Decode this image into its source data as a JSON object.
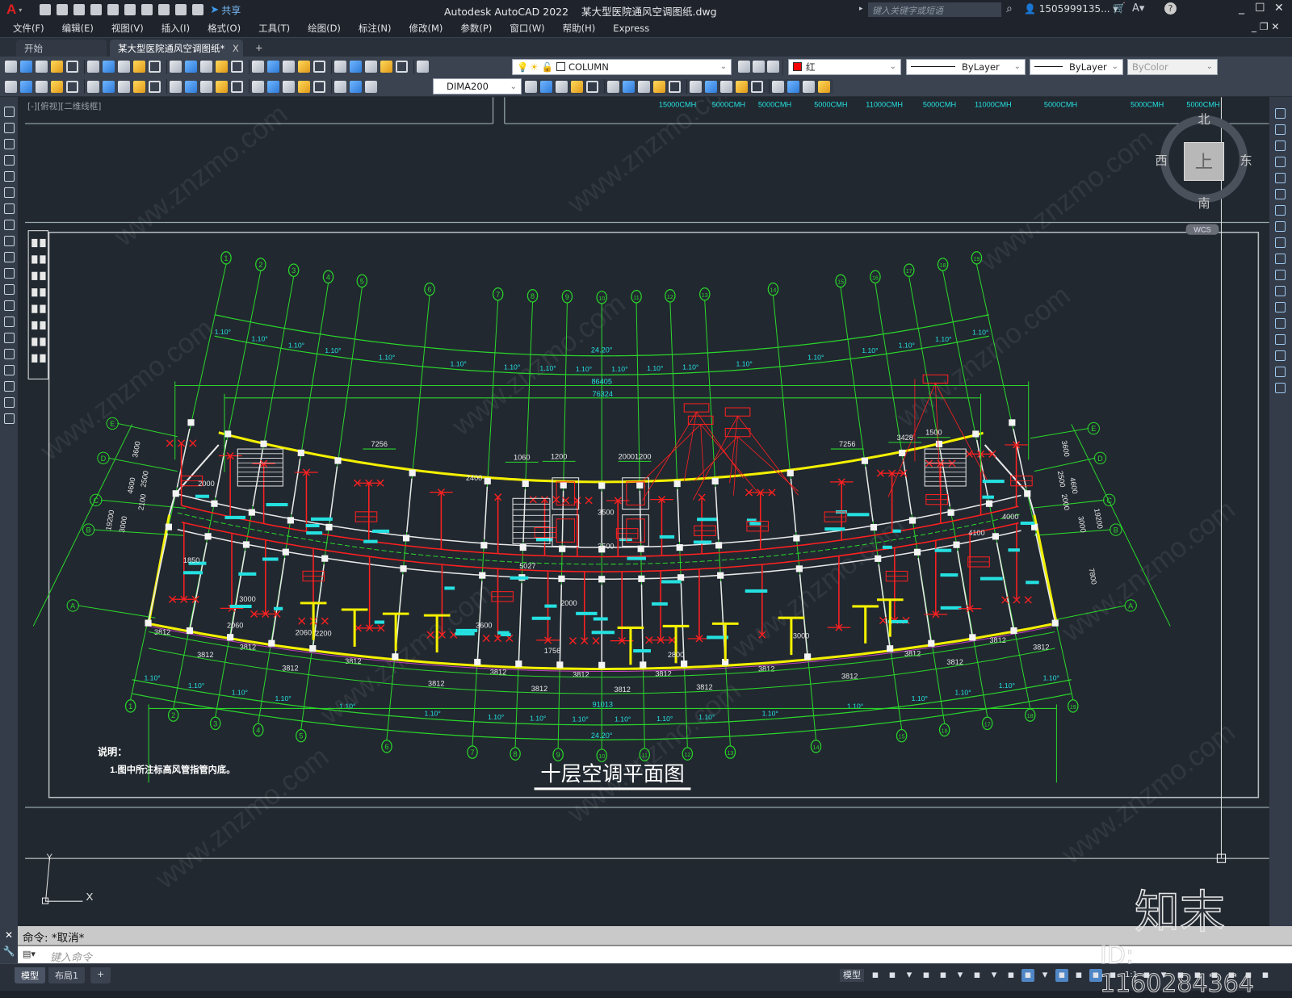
{
  "titlebar": {
    "logo": "A",
    "share_label": "共享",
    "title": "Autodesk AutoCAD 2022    某大型医院通风空调图纸.dwg",
    "search_placeholder": "键入关键字或短语",
    "user": "1505999135...",
    "quick_access_icons": [
      "new",
      "open",
      "save",
      "save-as",
      "open-from-web",
      "save-to-web",
      "plot",
      "undo",
      "redo",
      "customize"
    ]
  },
  "menu": [
    "文件(F)",
    "编辑(E)",
    "视图(V)",
    "插入(I)",
    "格式(O)",
    "工具(T)",
    "绘图(D)",
    "标注(N)",
    "修改(M)",
    "参数(P)",
    "窗口(W)",
    "帮助(H)",
    "Express"
  ],
  "tabs": {
    "start": "开始",
    "active": "某大型医院通风空调图纸*",
    "close": "X",
    "add": "+"
  },
  "toolbar1": {
    "icons_a": [
      "new",
      "open",
      "save",
      "plot",
      "plot-preview",
      "publish",
      "3d-print",
      "cut",
      "copy",
      "paste",
      "match-properties",
      "block-editor",
      "undo",
      "redo",
      "pan",
      "zoom-realtime",
      "zoom-window",
      "zoom-previous",
      "properties",
      "design-center",
      "tool-palettes",
      "sheet-set",
      "markup",
      "calculator",
      "help",
      "layer-properties"
    ],
    "layer": "COLUMN",
    "color": "红",
    "color_hex": "#ff0000",
    "linetype": "ByLayer",
    "lineweight": "ByLayer",
    "plotstyle": "ByColor"
  },
  "toolbar2": {
    "icons_a": [
      "text-edit",
      "check-spelling",
      "layer-state",
      "dim-linear",
      "dim-aligned",
      "dim-arc",
      "dim-ordinate",
      "dim-angular",
      "dim-jogged",
      "dim-diameter",
      "dim-radius",
      "quick-dim",
      "dim-baseline",
      "dim-continue",
      "dim-space",
      "dim-break",
      "tolerance",
      "center-mark",
      "inspect",
      "jogged-linear",
      "dim-edit",
      "dim-text-edit",
      "dim-update"
    ],
    "dimstyle": "DIMA200",
    "icons_b": [
      "dim-style",
      "solid-union",
      "solid-subtract",
      "solid-intersect",
      "extrude-faces",
      "move-faces",
      "offset-faces",
      "delete-faces",
      "rotate-faces",
      "taper-faces",
      "color-faces",
      "copy-faces",
      "color-edges",
      "copy-edges",
      "imprint",
      "clean",
      "separate",
      "shell",
      "check"
    ]
  },
  "viewport": {
    "label": "[-][俯视][二维线框]"
  },
  "viewcube": {
    "north": "北",
    "south": "南",
    "east": "东",
    "west": "西",
    "top": "上",
    "wcs": "WCS"
  },
  "drawing": {
    "airflow_labels": [
      "15000CMH",
      "5000CMH",
      "5000CMH",
      "5000CMH",
      "11000CMH",
      "5000CMH",
      "11000CMH",
      "5000CMH",
      "5000CMH",
      "5000CMH"
    ],
    "grid_labels": [
      "1",
      "2",
      "3",
      "4",
      "5",
      "6",
      "7",
      "8",
      "9",
      "10",
      "11",
      "12",
      "13",
      "14",
      "15",
      "16",
      "17",
      "18",
      "19"
    ],
    "axis_labels_left": [
      "E",
      "D",
      "C",
      "B",
      "A"
    ],
    "axis_labels_right": [
      "E",
      "D",
      "C",
      "B",
      "A"
    ],
    "angle_segment": "1.10°",
    "angle_total": "24.20°",
    "dim_overall_top": "86405",
    "dim_inner_top": "76324",
    "dim_overall_bottom": "91013",
    "bay_dim": "3812",
    "top_dims": [
      "7256",
      "1060",
      "1200",
      "20001200",
      "7256",
      "3428",
      "1500"
    ],
    "left_dims": [
      "3600",
      "4600",
      "2500",
      "2100",
      "19200",
      "3000"
    ],
    "right_dims": [
      "3600",
      "4600",
      "2500",
      "2000",
      "19200",
      "3000",
      "7800"
    ],
    "room_dims": [
      "2000",
      "1850",
      "3000",
      "2060",
      "2060",
      "2200",
      "3600",
      "2800",
      "2000",
      "3500",
      "3500",
      "5027",
      "1756",
      "3000",
      "4100",
      "4000",
      "2400"
    ],
    "notes_title": "说明：",
    "notes": [
      "1.图中所注标高风管指管内底。"
    ],
    "title": "十层空调平面图"
  },
  "command": {
    "history": "命令: *取消*",
    "placeholder": "键入命令"
  },
  "statusbar": {
    "model_tab": "模型",
    "layout_tab": "布局1",
    "add": "+",
    "model_label": "模型",
    "scale": "1:1"
  },
  "watermark": {
    "logo": "知末",
    "id": "ID: 1160284364",
    "site": "www.znzmo.com"
  }
}
